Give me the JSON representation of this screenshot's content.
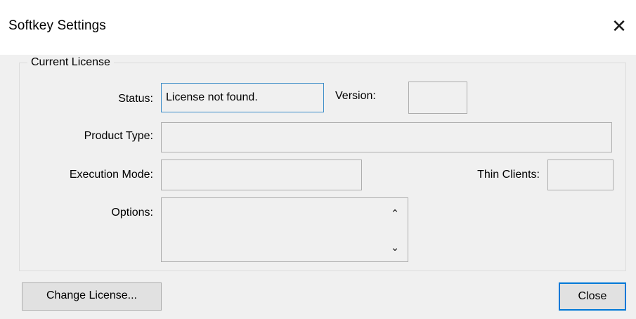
{
  "window": {
    "title": "Softkey Settings",
    "close_glyph": "✕"
  },
  "current_license": {
    "group_label": "Current License",
    "status_label": "Status:",
    "status_value": "License not found.",
    "version_label": "Version:",
    "version_value": "",
    "product_type_label": "Product Type:",
    "product_type_value": "",
    "execution_mode_label": "Execution Mode:",
    "execution_mode_value": "",
    "thin_clients_label": "Thin Clients:",
    "thin_clients_value": "",
    "options_label": "Options:",
    "options_value": "",
    "scroll_up_glyph": "⌃",
    "scroll_down_glyph": "⌄"
  },
  "buttons": {
    "change_license": "Change License...",
    "close": "Close"
  },
  "colors": {
    "titlebar": "#ffffff",
    "background": "#f0f0f0",
    "focus_border": "#3c8dc8",
    "default_button_border": "#0078d7"
  }
}
